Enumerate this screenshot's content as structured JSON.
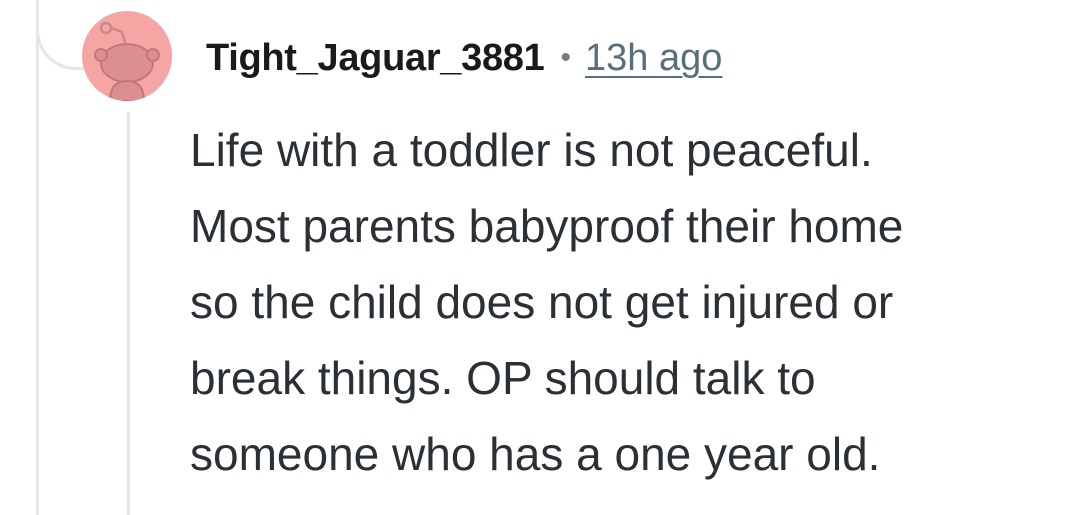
{
  "comment": {
    "avatar": {
      "icon": "snoo-avatar-icon",
      "background_color": "#f6a5a5"
    },
    "author": "Tight_Jaguar_3881",
    "separator": "•",
    "timestamp": "13h ago",
    "body_lines": [
      "Life with a toddler is not peaceful.",
      "Most parents babyproof their home",
      "so the child does not get injured or",
      "break things. OP should talk to",
      "someone who has a one year old."
    ]
  }
}
